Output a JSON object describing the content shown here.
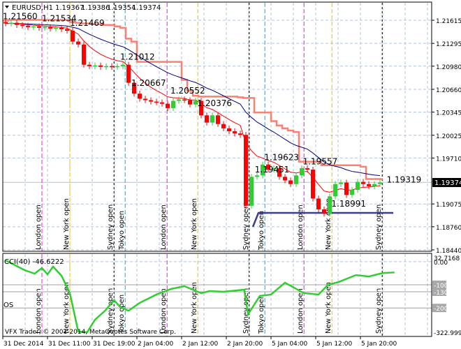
{
  "header": {
    "symbol": "EURUSD,H1",
    "open": "1.19367",
    "high": "1.19386",
    "low": "1.19354",
    "close": "1.19374"
  },
  "current_price_tag": "1.19374",
  "price_axis": [
    "1.21615",
    "1.21295",
    "1.20980",
    "1.20660",
    "1.20345",
    "1.20025",
    "1.19710",
    "1.19075",
    "1.18760",
    "1.18440"
  ],
  "time_axis": [
    "31 Dec 2014",
    "31 Dec 11:00",
    "31 Dec 19:00",
    "2 Jan 04:00",
    "2 Jan 12:00",
    "2 Jan 20:00",
    "5 Jan 04:00",
    "5 Jan 12:00",
    "5 Jan 20:00"
  ],
  "cci": {
    "title": "CCI(40) -46.6222",
    "axis_top": "32.7168",
    "axis_zero": "0.00",
    "axis_bottom": "-322.9997",
    "levels": [
      "-100",
      "-130",
      "-200"
    ],
    "os_label": "OS",
    "bars": [
      0,
      3.4,
      5.2,
      6.5,
      7.5,
      8.5,
      10,
      11.5,
      13,
      14.6,
      16,
      17.8,
      19.4,
      20.5,
      22,
      24,
      27,
      29.6,
      32,
      35,
      36.5,
      39,
      42.7,
      43.4,
      45.5,
      47.5,
      50,
      53.4,
      56,
      57.7,
      59.6,
      62.7,
      65,
      67.5,
      69.6
    ],
    "values": [
      5.6,
      -36.6,
      -51.7,
      -27.6,
      -54.7,
      -21.5,
      -60.7,
      -136,
      -302,
      -305,
      -251,
      -212,
      -166,
      -196,
      -212,
      -178,
      -142,
      -118,
      -106,
      -136,
      -127,
      -130,
      -121,
      -227,
      -148,
      -142,
      -91,
      -136,
      -142,
      -100,
      -88,
      -58,
      -64,
      -49,
      -46.6
    ]
  },
  "watermark": "VFX Trader, © 2001-2014, MetaQuotes Software Corp.",
  "chart_data": {
    "type": "candlestick",
    "closes": [
      1.2157,
      1.2158,
      1.2155,
      1.2154,
      1.2152,
      1.2153,
      1.2151,
      1.2152,
      1.215,
      1.2151,
      1.2149,
      1.2147,
      1.2132,
      1.2128,
      1.21,
      1.2098,
      1.2099,
      1.2097,
      1.2098,
      1.2097,
      1.2098,
      1.21,
      1.2075,
      1.206,
      1.2053,
      1.2051,
      1.2049,
      1.2048,
      1.2046,
      1.204,
      1.205,
      1.2052,
      1.2051,
      1.2045,
      1.205,
      1.203,
      1.202,
      1.203,
      1.2018,
      1.2012,
      1.2008,
      1.2005,
      1.2003,
      1.1905,
      1.1945,
      1.1947,
      1.1962,
      1.1955,
      1.1957,
      1.1945,
      1.194,
      1.1935,
      1.1947,
      1.1957,
      1.1955,
      1.1915,
      1.19,
      1.1894,
      1.1918,
      1.1935,
      1.1937,
      1.192,
      1.1927,
      1.1938,
      1.1935,
      1.1932,
      1.1935,
      1.1937
    ],
    "ylim": [
      1.1844,
      1.2162
    ],
    "price_labels": [
      {
        "text": "1.21560",
        "bar": -0.5,
        "price": 1.2163
      },
      {
        "text": "1.21534",
        "bar": 6.5,
        "price": 1.216
      },
      {
        "text": "1.21469",
        "bar": 11.5,
        "price": 1.2154
      },
      {
        "text": "1.21012",
        "bar": 20.5,
        "price": 1.2107
      },
      {
        "text": "1.20667",
        "bar": 22.5,
        "price": 1.2071
      },
      {
        "text": "1.20552",
        "bar": 29.5,
        "price": 1.206
      },
      {
        "text": "1.20376",
        "bar": 34.3,
        "price": 1.2043
      },
      {
        "text": "1.19623",
        "bar": 46.3,
        "price": 1.1968
      },
      {
        "text": "1.19451",
        "bar": 44.6,
        "price": 1.1951
      },
      {
        "text": "1.19557",
        "bar": 53.2,
        "price": 1.1962
      },
      {
        "text": "1.18991",
        "bar": 58.3,
        "price": 1.1904
      },
      {
        "text": "1.19319",
        "bar": 68.2,
        "price": 1.1937
      }
    ],
    "sessions": [
      {
        "name": "London open",
        "bar": 6.5,
        "color": "#e020e0"
      },
      {
        "name": "New York open",
        "bar": 11.5,
        "color": "#f0c000"
      },
      {
        "name": "Sydney open",
        "bar": 19.4,
        "color": "#000000"
      },
      {
        "name": "Tokyo open",
        "bar": 21.4,
        "color": "#00b0f0"
      },
      {
        "name": "London open",
        "bar": 28.9,
        "color": "#e020e0"
      },
      {
        "name": "New York open",
        "bar": 34.4,
        "color": "#f0c000"
      },
      {
        "name": "Sydney open",
        "bar": 43.6,
        "color": "#000000"
      },
      {
        "name": "Tokyo open",
        "bar": 46.4,
        "color": "#00b0f0"
      },
      {
        "name": "London open",
        "bar": 53.4,
        "color": "#e020e0"
      },
      {
        "name": "New York open",
        "bar": 58.4,
        "color": "#f0c000"
      },
      {
        "name": "Sydney open",
        "bar": 67.4,
        "color": "#000000"
      }
    ]
  }
}
